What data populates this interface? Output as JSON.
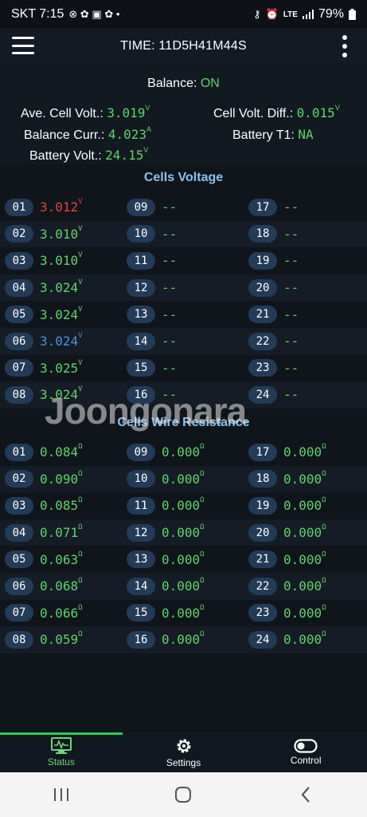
{
  "status_bar": {
    "carrier_time": "SKT 7:15",
    "battery": "79%",
    "network": "LTE"
  },
  "app_bar": {
    "title": "TIME: 11D5H41M44S",
    "menu_icon": "hamburger-icon",
    "overflow_icon": "kebab-icon"
  },
  "info": {
    "balance_label": "Balance:",
    "balance_value": "ON",
    "ave_cell_volt_label": "Ave. Cell Volt.:",
    "ave_cell_volt_value": "3.019",
    "cell_volt_diff_label": "Cell Volt. Diff.:",
    "cell_volt_diff_value": "0.015",
    "balance_curr_label": "Balance Curr.:",
    "balance_curr_value": "4.023",
    "battery_t1_label": "Battery T1:",
    "battery_t1_value": "NA",
    "battery_volt_label": "Battery Volt.:",
    "battery_volt_value": "24.15",
    "unit_v": "V",
    "unit_a": "A"
  },
  "cells_voltage": {
    "title": "Cells Voltage",
    "unit": "V",
    "cells": [
      {
        "id": "01",
        "value": "3.012",
        "color": "red"
      },
      {
        "id": "02",
        "value": "3.010",
        "color": "green"
      },
      {
        "id": "03",
        "value": "3.010",
        "color": "green"
      },
      {
        "id": "04",
        "value": "3.024",
        "color": "green"
      },
      {
        "id": "05",
        "value": "3.024",
        "color": "green"
      },
      {
        "id": "06",
        "value": "3.024",
        "color": "blue"
      },
      {
        "id": "07",
        "value": "3.025",
        "color": "green"
      },
      {
        "id": "08",
        "value": "3.024",
        "color": "green"
      },
      {
        "id": "09",
        "value": "--"
      },
      {
        "id": "10",
        "value": "--"
      },
      {
        "id": "11",
        "value": "--"
      },
      {
        "id": "12",
        "value": "--"
      },
      {
        "id": "13",
        "value": "--"
      },
      {
        "id": "14",
        "value": "--"
      },
      {
        "id": "15",
        "value": "--"
      },
      {
        "id": "16",
        "value": "--"
      },
      {
        "id": "17",
        "value": "--"
      },
      {
        "id": "18",
        "value": "--"
      },
      {
        "id": "19",
        "value": "--"
      },
      {
        "id": "20",
        "value": "--"
      },
      {
        "id": "21",
        "value": "--"
      },
      {
        "id": "22",
        "value": "--"
      },
      {
        "id": "23",
        "value": "--"
      },
      {
        "id": "24",
        "value": "--"
      }
    ]
  },
  "cells_wire_resistance": {
    "title": "Cells Wire Resistance",
    "unit": "Ω",
    "cells": [
      {
        "id": "01",
        "value": "0.084"
      },
      {
        "id": "02",
        "value": "0.090"
      },
      {
        "id": "03",
        "value": "0.085"
      },
      {
        "id": "04",
        "value": "0.071"
      },
      {
        "id": "05",
        "value": "0.063"
      },
      {
        "id": "06",
        "value": "0.068"
      },
      {
        "id": "07",
        "value": "0.066"
      },
      {
        "id": "08",
        "value": "0.059"
      },
      {
        "id": "09",
        "value": "0.000"
      },
      {
        "id": "10",
        "value": "0.000"
      },
      {
        "id": "11",
        "value": "0.000"
      },
      {
        "id": "12",
        "value": "0.000"
      },
      {
        "id": "13",
        "value": "0.000"
      },
      {
        "id": "14",
        "value": "0.000"
      },
      {
        "id": "15",
        "value": "0.000"
      },
      {
        "id": "16",
        "value": "0.000"
      },
      {
        "id": "17",
        "value": "0.000"
      },
      {
        "id": "18",
        "value": "0.000"
      },
      {
        "id": "19",
        "value": "0.000"
      },
      {
        "id": "20",
        "value": "0.000"
      },
      {
        "id": "21",
        "value": "0.000"
      },
      {
        "id": "22",
        "value": "0.000"
      },
      {
        "id": "23",
        "value": "0.000"
      },
      {
        "id": "24",
        "value": "0.000"
      }
    ]
  },
  "watermark": "Joongonara",
  "bottom_nav": [
    {
      "label": "Status",
      "icon": "monitor-icon",
      "active": true
    },
    {
      "label": "Settings",
      "icon": "gear-icon",
      "active": false
    },
    {
      "label": "Control",
      "icon": "toggle-icon",
      "active": false
    }
  ],
  "colors": {
    "green": "#61d36b",
    "red": "#e2443b",
    "blue": "#4a90e2",
    "header_blue": "#8cc2ee",
    "pill": "#243b57"
  }
}
